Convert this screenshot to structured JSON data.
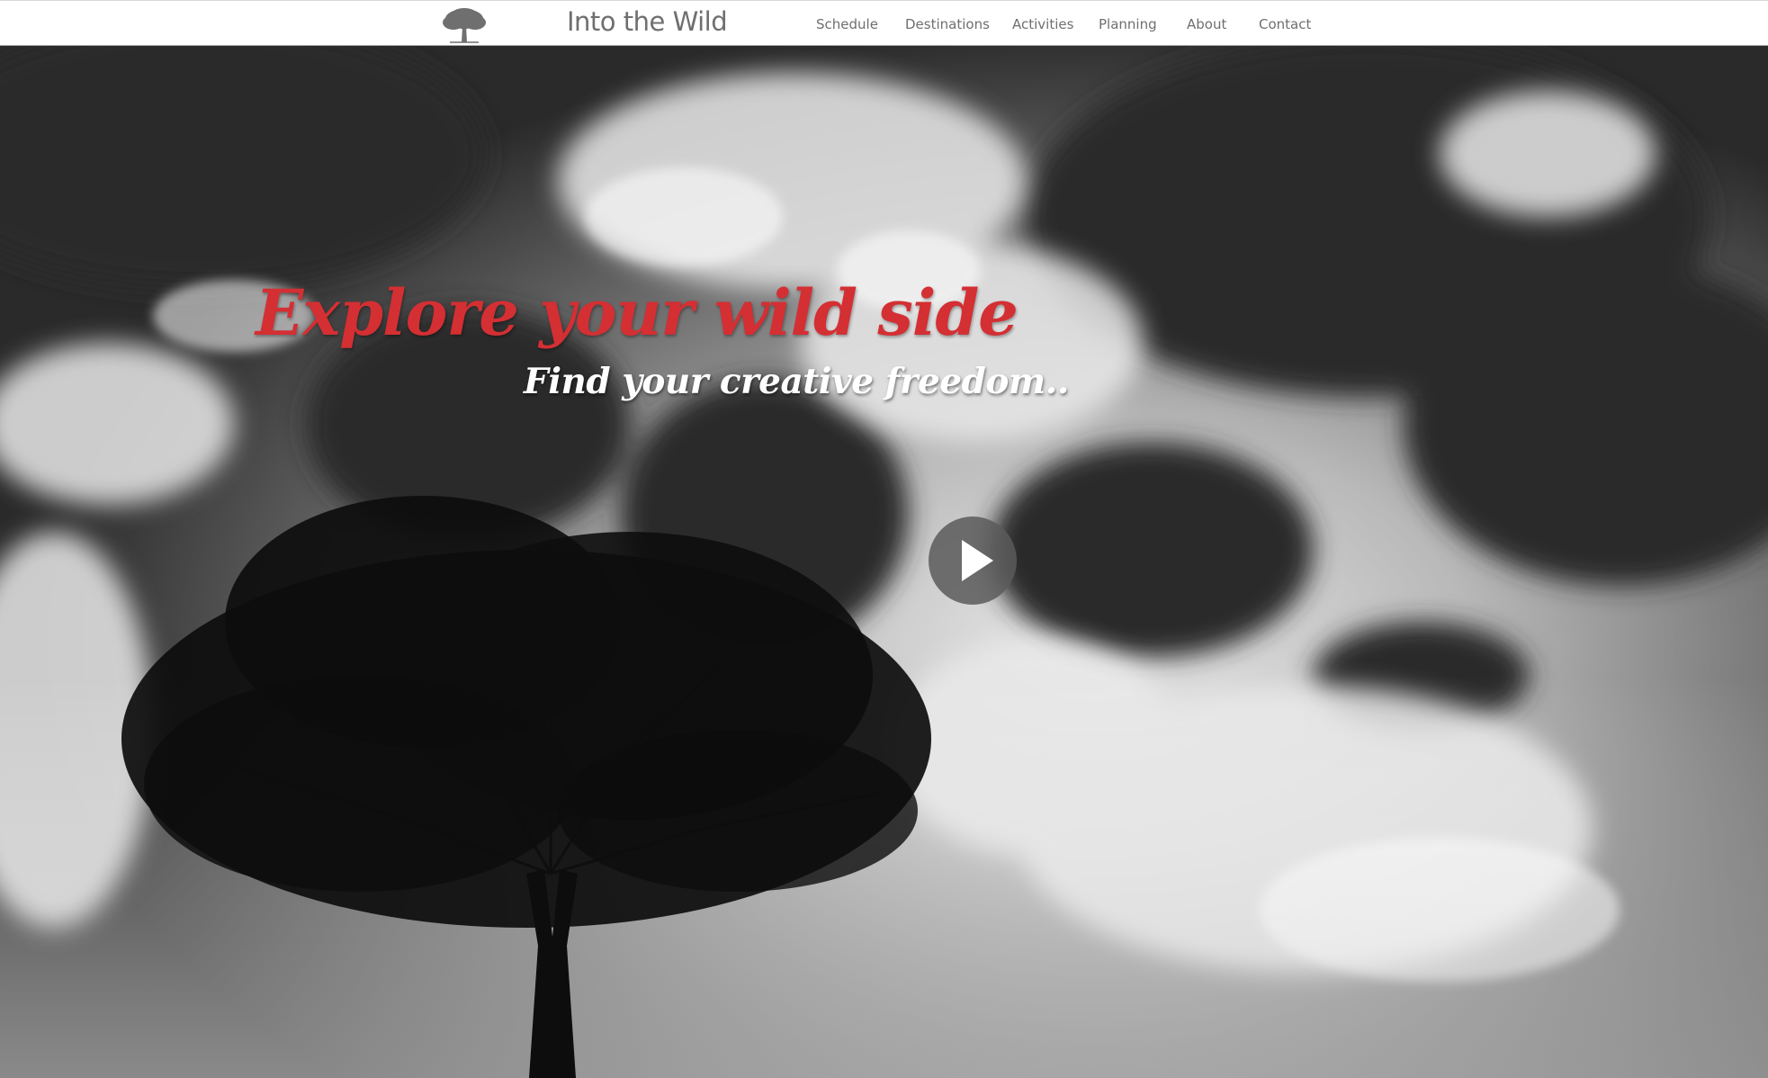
{
  "header": {
    "brand": "Into the Wild",
    "logo_icon": "tree-icon",
    "nav": [
      {
        "label": "Schedule"
      },
      {
        "label": "Destinations"
      },
      {
        "label": "Activities"
      },
      {
        "label": "Planning"
      },
      {
        "label": "About"
      },
      {
        "label": "Contact"
      }
    ]
  },
  "hero": {
    "headline": "Explore your wild side",
    "subheadline": "Find your creative freedom..",
    "play_icon": "play-icon"
  },
  "colors": {
    "accent": "#d42f33",
    "nav_text": "#6f6f6f",
    "header_bg": "#ffffff"
  }
}
